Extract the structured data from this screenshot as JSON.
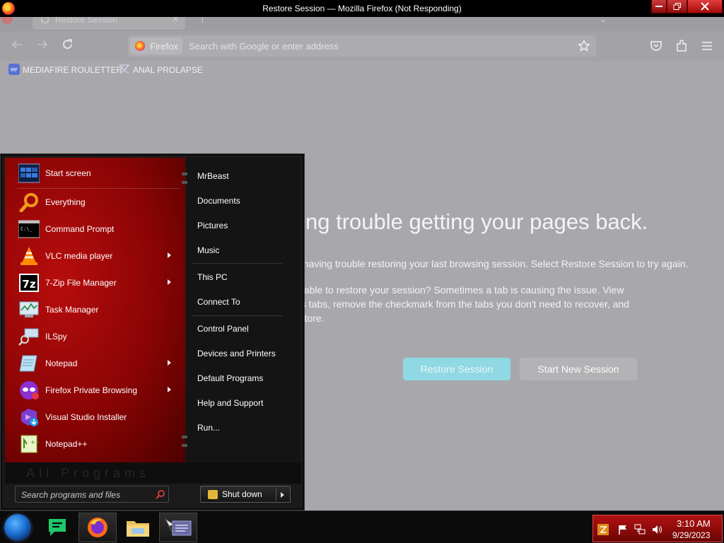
{
  "window": {
    "title": "Restore Session — Mozilla Firefox (Not Responding)"
  },
  "tabs": [
    {
      "title": "Restore Session"
    }
  ],
  "urlbar": {
    "identity_label": "Firefox",
    "placeholder": "Search with Google or enter address"
  },
  "bookmarks": [
    {
      "label": "MEDIAFIRE ROULETTER",
      "icon": "mediafire-icon"
    },
    {
      "label": "ANAL PROLAPSE",
      "icon": "page-icon"
    }
  ],
  "page": {
    "heading": "Having trouble getting your pages back.",
    "paragraph1": "We are having trouble restoring your last browsing session. Select Restore Session to try again.",
    "paragraph2": "Still not able to restore your session? Sometimes a tab is causing the issue. View previous tabs, remove the checkmark from the tabs you don't need to recover, and then restore.",
    "restore_button": "Restore Session",
    "new_session_button": "Start New Session"
  },
  "start_menu": {
    "pinned": [
      {
        "label": "Start screen",
        "icon": "start-screen-icon",
        "submenu": false
      },
      {
        "label": "Everything",
        "icon": "magnifier-icon",
        "submenu": false
      },
      {
        "label": "Command Prompt",
        "icon": "command-prompt-icon",
        "submenu": false
      },
      {
        "label": "VLC media player",
        "icon": "vlc-cone-icon",
        "submenu": true
      },
      {
        "label": "7-Zip File Manager",
        "icon": "seven-zip-icon",
        "submenu": true
      },
      {
        "label": "Task Manager",
        "icon": "task-manager-icon",
        "submenu": false
      },
      {
        "label": "ILSpy",
        "icon": "ilspy-icon",
        "submenu": false
      },
      {
        "label": "Notepad",
        "icon": "notepad-icon",
        "submenu": true
      },
      {
        "label": "Firefox Private Browsing",
        "icon": "private-browsing-icon",
        "submenu": true
      },
      {
        "label": "Visual Studio Installer",
        "icon": "visual-studio-installer-icon",
        "submenu": false
      },
      {
        "label": "Notepad++",
        "icon": "notepad-plus-plus-icon",
        "submenu": false
      }
    ],
    "links": [
      "MrBeast",
      "Documents",
      "Pictures",
      "Music",
      "This PC",
      "Connect To",
      "Control Panel",
      "Devices and Printers",
      "Default Programs",
      "Help and Support",
      "Run..."
    ],
    "lower_strip_text": "All Programs",
    "search_placeholder": "Search programs and files",
    "shutdown_label": "Shut down"
  },
  "taskbar": {
    "apps": [
      "chat-app-icon",
      "firefox-icon",
      "file-explorer-icon",
      "remote-desktop-icon"
    ],
    "tray_icons": [
      "firefox-update-icon",
      "action-center-flag-icon",
      "network-icon",
      "volume-icon"
    ],
    "time": "3:10 AM",
    "date": "9/29/2023"
  },
  "colors": {
    "start_menu_accent": "#a80606",
    "tray_accent": "#b21212",
    "restore_button": "#8fd8e4",
    "page_overlay": "#a8a8ac"
  }
}
